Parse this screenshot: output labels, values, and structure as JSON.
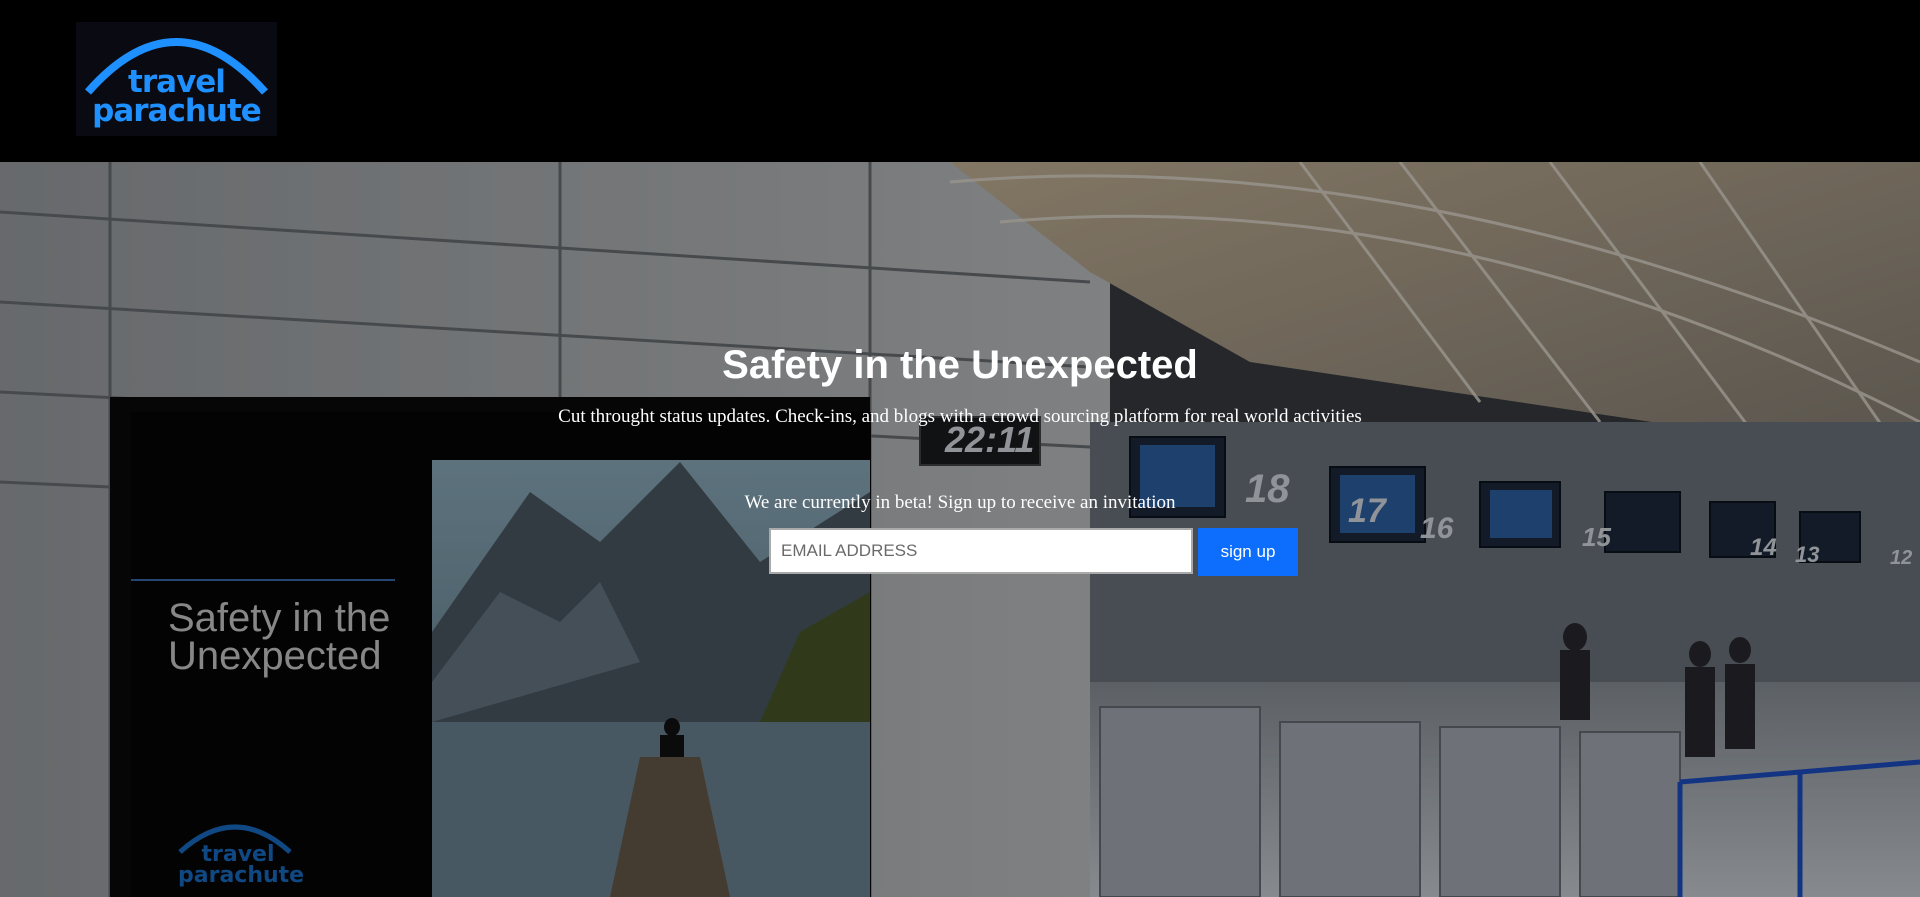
{
  "brand": {
    "logo_text_line1": "travel",
    "logo_text_line2": "parachute",
    "logo_color": "#1e90ff"
  },
  "hero": {
    "headline": "Safety in the Unexpected",
    "subheadline": "Cut throught status updates. Check-ins, and blogs with a crowd sourcing platform for real world activities",
    "beta_note": "We are currently in beta! Sign up to receive an invitation",
    "email_placeholder": "EMAIL ADDRESS",
    "signup_label": "sign up",
    "accent_color": "#0d6efd"
  },
  "background": {
    "poster_title": "Safety in the Unexpected",
    "poster_logo_line1": "travel",
    "poster_logo_line2": "parachute",
    "clock": "22:11",
    "counters": [
      "18",
      "17",
      "16",
      "15",
      "14",
      "13",
      "12"
    ]
  }
}
